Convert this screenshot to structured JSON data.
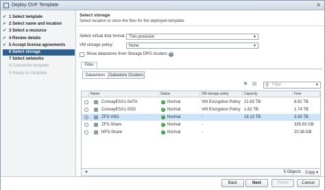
{
  "window": {
    "title": "Deploy OVF Template",
    "close_glyph": "✕"
  },
  "steps": [
    {
      "label": "1 Select template",
      "state": "done"
    },
    {
      "label": "2 Select name and location",
      "state": "done"
    },
    {
      "label": "3 Select a resource",
      "state": "done"
    },
    {
      "label": "4 Review details",
      "state": "done"
    },
    {
      "label": "5 Accept license agreements",
      "state": "done"
    },
    {
      "label": "6 Select storage",
      "state": "active"
    },
    {
      "label": "7 Select networks",
      "state": "upcoming"
    },
    {
      "label": "8 Customize template",
      "state": "pending"
    },
    {
      "label": "9 Ready to complete",
      "state": "pending"
    }
  ],
  "page": {
    "heading": "Select storage",
    "subheading": "Select location to store the files for the deployed template."
  },
  "form": {
    "disk_format_label": "Select virtual disk format:",
    "disk_format_value": "Thin provision",
    "vm_policy_label": "VM storage policy:",
    "vm_policy_value": "None",
    "drs_checkbox_label": "Show datastores from Storage DRS clusters",
    "drs_checked": false
  },
  "tabs": {
    "filter": "Filter",
    "datastores": "Datastores",
    "datastore_clusters": "Datastore Clusters"
  },
  "search": {
    "placeholder": "Filter"
  },
  "table": {
    "columns": [
      "Name",
      "Status",
      "VM storage policy",
      "Capacity",
      "Free"
    ],
    "rows": [
      {
        "name": "ConvayESX1-SATA",
        "status": "Normal",
        "policy": "VM Encryption Policy",
        "capacity": "21.83 TB",
        "free": "6.82 TB",
        "selected": false
      },
      {
        "name": "ConvayESX1-SSD",
        "status": "Normal",
        "policy": "VM Encryption Policy",
        "capacity": "1.82 TB",
        "free": "1.74 TB",
        "selected": false
      },
      {
        "name": "ZFS-VM1",
        "status": "Normal",
        "policy": "-",
        "capacity": "18.13 TB",
        "free": "3.35 TB",
        "selected": true
      },
      {
        "name": "ZFS-Share",
        "status": "Normal",
        "policy": "-",
        "capacity": "",
        "free": "335.83 GB",
        "selected": false
      },
      {
        "name": "NFS-Share",
        "status": "Normal",
        "policy": "-",
        "capacity": "",
        "free": "20.38 GB",
        "selected": false
      }
    ],
    "count_text": "5 Objects",
    "copy_label": "Copy"
  },
  "buttons": {
    "back": "Back",
    "next": "Next",
    "finish": "Finish",
    "cancel": "Cancel"
  },
  "colors": {
    "accent": "#2f5e8c",
    "ok": "#3a9a3a",
    "selected_row": "#cde3f7"
  }
}
